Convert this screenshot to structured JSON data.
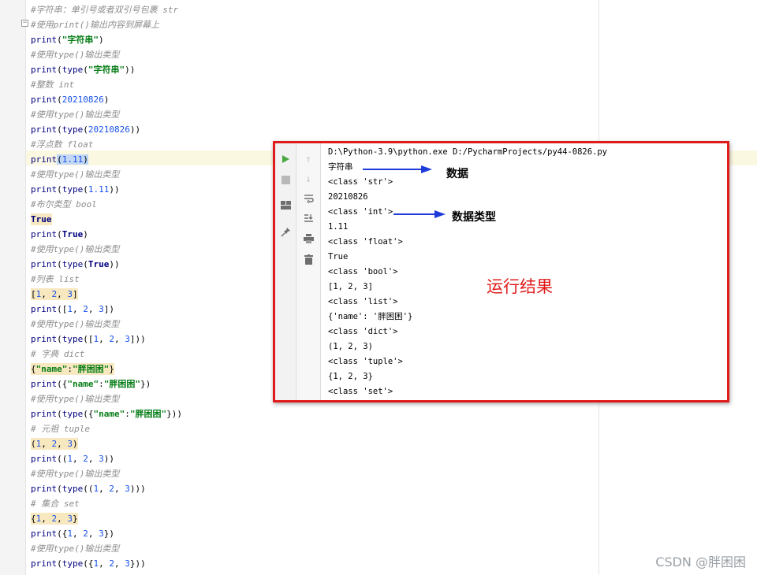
{
  "editor": {
    "lines": [
      {
        "kind": "comment",
        "text": "#字符串：单引号或者双引号包裹 str"
      },
      {
        "kind": "comment",
        "text": "#使用print()输出内容到屏幕上"
      },
      {
        "kind": "code",
        "parts": [
          {
            "c": "kw",
            "t": "print"
          },
          {
            "c": "",
            "t": "("
          },
          {
            "c": "str",
            "t": "\"字符串\""
          },
          {
            "c": "",
            "t": ")"
          }
        ]
      },
      {
        "kind": "comment",
        "text": "#使用type()输出类型"
      },
      {
        "kind": "code",
        "parts": [
          {
            "c": "kw",
            "t": "print"
          },
          {
            "c": "",
            "t": "("
          },
          {
            "c": "kw",
            "t": "type"
          },
          {
            "c": "",
            "t": "("
          },
          {
            "c": "str",
            "t": "\"字符串\""
          },
          {
            "c": "",
            "t": "))"
          }
        ]
      },
      {
        "kind": "comment",
        "text": "#整数 int"
      },
      {
        "kind": "code",
        "parts": [
          {
            "c": "kw",
            "t": "print"
          },
          {
            "c": "",
            "t": "("
          },
          {
            "c": "num",
            "t": "20210826"
          },
          {
            "c": "",
            "t": ")"
          }
        ]
      },
      {
        "kind": "comment",
        "text": "#使用type()输出类型"
      },
      {
        "kind": "code",
        "parts": [
          {
            "c": "kw",
            "t": "print"
          },
          {
            "c": "",
            "t": "("
          },
          {
            "c": "kw",
            "t": "type"
          },
          {
            "c": "",
            "t": "("
          },
          {
            "c": "num",
            "t": "20210826"
          },
          {
            "c": "",
            "t": "))"
          }
        ]
      },
      {
        "kind": "comment",
        "text": "#浮点数 float"
      },
      {
        "kind": "code",
        "parts": [
          {
            "c": "kw",
            "t": "print"
          },
          {
            "c": "brace-hl",
            "t": "("
          },
          {
            "c": "selnum",
            "t": "1.11"
          },
          {
            "c": "brace-hl",
            "t": ")"
          }
        ]
      },
      {
        "kind": "comment",
        "text": "#使用type()输出类型"
      },
      {
        "kind": "code",
        "parts": [
          {
            "c": "kw",
            "t": "print"
          },
          {
            "c": "",
            "t": "("
          },
          {
            "c": "kw",
            "t": "type"
          },
          {
            "c": "",
            "t": "("
          },
          {
            "c": "num",
            "t": "1.11"
          },
          {
            "c": "",
            "t": "))"
          }
        ]
      },
      {
        "kind": "comment",
        "text": "#布尔类型 bool"
      },
      {
        "kind": "code",
        "parts": [
          {
            "c": "kbold hl",
            "t": "True"
          }
        ]
      },
      {
        "kind": "code",
        "parts": [
          {
            "c": "kw",
            "t": "print"
          },
          {
            "c": "",
            "t": "("
          },
          {
            "c": "kbold",
            "t": "True"
          },
          {
            "c": "",
            "t": ")"
          }
        ]
      },
      {
        "kind": "comment",
        "text": "#使用type()输出类型"
      },
      {
        "kind": "code",
        "parts": [
          {
            "c": "kw",
            "t": "print"
          },
          {
            "c": "",
            "t": "("
          },
          {
            "c": "kw",
            "t": "type"
          },
          {
            "c": "",
            "t": "("
          },
          {
            "c": "kbold",
            "t": "True"
          },
          {
            "c": "",
            "t": "))"
          }
        ]
      },
      {
        "kind": "comment",
        "text": "#列表 list"
      },
      {
        "kind": "code",
        "parts": [
          {
            "c": "hl",
            "t": "["
          },
          {
            "c": "num hl",
            "t": "1"
          },
          {
            "c": "hl",
            "t": ", "
          },
          {
            "c": "num hl",
            "t": "2"
          },
          {
            "c": "hl",
            "t": ", "
          },
          {
            "c": "num hl",
            "t": "3"
          },
          {
            "c": "hl",
            "t": "]"
          }
        ]
      },
      {
        "kind": "code",
        "parts": [
          {
            "c": "kw",
            "t": "print"
          },
          {
            "c": "",
            "t": "(["
          },
          {
            "c": "num",
            "t": "1"
          },
          {
            "c": "",
            "t": ", "
          },
          {
            "c": "num",
            "t": "2"
          },
          {
            "c": "",
            "t": ", "
          },
          {
            "c": "num",
            "t": "3"
          },
          {
            "c": "",
            "t": "])"
          }
        ]
      },
      {
        "kind": "comment",
        "text": "#使用type()输出类型"
      },
      {
        "kind": "code",
        "parts": [
          {
            "c": "kw",
            "t": "print"
          },
          {
            "c": "",
            "t": "("
          },
          {
            "c": "kw",
            "t": "type"
          },
          {
            "c": "",
            "t": "(["
          },
          {
            "c": "num",
            "t": "1"
          },
          {
            "c": "",
            "t": ", "
          },
          {
            "c": "num",
            "t": "2"
          },
          {
            "c": "",
            "t": ", "
          },
          {
            "c": "num",
            "t": "3"
          },
          {
            "c": "",
            "t": "]))"
          }
        ]
      },
      {
        "kind": "comment",
        "text": "# 字典 dict"
      },
      {
        "kind": "code",
        "parts": [
          {
            "c": "hl",
            "t": "{"
          },
          {
            "c": "str hl",
            "t": "\"name\""
          },
          {
            "c": "hl",
            "t": ":"
          },
          {
            "c": "str hl",
            "t": "\"胖困困\""
          },
          {
            "c": "hl",
            "t": "}"
          }
        ]
      },
      {
        "kind": "code",
        "parts": [
          {
            "c": "kw",
            "t": "print"
          },
          {
            "c": "",
            "t": "({"
          },
          {
            "c": "str",
            "t": "\"name\""
          },
          {
            "c": "",
            "t": ":"
          },
          {
            "c": "str",
            "t": "\"胖困困\""
          },
          {
            "c": "",
            "t": "})"
          }
        ]
      },
      {
        "kind": "comment",
        "text": "#使用type()输出类型"
      },
      {
        "kind": "code",
        "parts": [
          {
            "c": "kw",
            "t": "print"
          },
          {
            "c": "",
            "t": "("
          },
          {
            "c": "kw",
            "t": "type"
          },
          {
            "c": "",
            "t": "({"
          },
          {
            "c": "str",
            "t": "\"name\""
          },
          {
            "c": "",
            "t": ":"
          },
          {
            "c": "str",
            "t": "\"胖困困\""
          },
          {
            "c": "",
            "t": "}))"
          }
        ]
      },
      {
        "kind": "comment",
        "text": "# 元祖 tuple"
      },
      {
        "kind": "code",
        "parts": [
          {
            "c": "hl",
            "t": "("
          },
          {
            "c": "num hl",
            "t": "1"
          },
          {
            "c": "hl",
            "t": ", "
          },
          {
            "c": "num hl",
            "t": "2"
          },
          {
            "c": "hl",
            "t": ", "
          },
          {
            "c": "num hl",
            "t": "3"
          },
          {
            "c": "hl",
            "t": ")"
          }
        ]
      },
      {
        "kind": "code",
        "parts": [
          {
            "c": "kw",
            "t": "print"
          },
          {
            "c": "",
            "t": "(("
          },
          {
            "c": "num",
            "t": "1"
          },
          {
            "c": "",
            "t": ", "
          },
          {
            "c": "num",
            "t": "2"
          },
          {
            "c": "",
            "t": ", "
          },
          {
            "c": "num",
            "t": "3"
          },
          {
            "c": "",
            "t": "))"
          }
        ]
      },
      {
        "kind": "comment",
        "text": "#使用type()输出类型"
      },
      {
        "kind": "code",
        "parts": [
          {
            "c": "kw",
            "t": "print"
          },
          {
            "c": "",
            "t": "("
          },
          {
            "c": "kw",
            "t": "type"
          },
          {
            "c": "",
            "t": "(("
          },
          {
            "c": "num",
            "t": "1"
          },
          {
            "c": "",
            "t": ", "
          },
          {
            "c": "num",
            "t": "2"
          },
          {
            "c": "",
            "t": ", "
          },
          {
            "c": "num",
            "t": "3"
          },
          {
            "c": "",
            "t": ")))"
          }
        ]
      },
      {
        "kind": "comment",
        "text": "# 集合 set"
      },
      {
        "kind": "code",
        "parts": [
          {
            "c": "hl",
            "t": "{"
          },
          {
            "c": "num hl",
            "t": "1"
          },
          {
            "c": "hl",
            "t": ", "
          },
          {
            "c": "num hl",
            "t": "2"
          },
          {
            "c": "hl",
            "t": ", "
          },
          {
            "c": "num hl",
            "t": "3"
          },
          {
            "c": "hl",
            "t": "}"
          }
        ]
      },
      {
        "kind": "code",
        "parts": [
          {
            "c": "kw",
            "t": "print"
          },
          {
            "c": "",
            "t": "({"
          },
          {
            "c": "num",
            "t": "1"
          },
          {
            "c": "",
            "t": ", "
          },
          {
            "c": "num",
            "t": "2"
          },
          {
            "c": "",
            "t": ", "
          },
          {
            "c": "num",
            "t": "3"
          },
          {
            "c": "",
            "t": "})"
          }
        ]
      },
      {
        "kind": "comment",
        "text": "#使用type()输出类型"
      },
      {
        "kind": "code",
        "parts": [
          {
            "c": "kw",
            "t": "print"
          },
          {
            "c": "",
            "t": "("
          },
          {
            "c": "kw",
            "t": "type"
          },
          {
            "c": "",
            "t": "({"
          },
          {
            "c": "num",
            "t": "1"
          },
          {
            "c": "",
            "t": ", "
          },
          {
            "c": "num",
            "t": "2"
          },
          {
            "c": "",
            "t": ", "
          },
          {
            "c": "num",
            "t": "3"
          },
          {
            "c": "",
            "t": "}))"
          }
        ]
      }
    ]
  },
  "run_panel": {
    "command": "D:\\Python-3.9\\python.exe D:/PycharmProjects/py44-0826.py",
    "output": [
      "字符串",
      "<class 'str'>",
      "20210826",
      "<class 'int'>",
      "1.11",
      "<class 'float'>",
      "True",
      "<class 'bool'>",
      "[1, 2, 3]",
      "<class 'list'>",
      "{'name': '胖困困'}",
      "<class 'dict'>",
      "(1, 2, 3)",
      "<class 'tuple'>",
      "{1, 2, 3}",
      "<class 'set'>"
    ],
    "annotation_data": "数据",
    "annotation_type": "数据类型",
    "result_label": "运行结果",
    "toolbar_icons": [
      "run-icon",
      "stop-icon",
      "layout-icon",
      "pin-icon",
      "up-arrow-icon",
      "down-arrow-icon",
      "soft-wrap-icon",
      "scroll-to-end-icon",
      "print-icon",
      "trash-icon"
    ]
  },
  "watermark": "CSDN @胖困困",
  "colors": {
    "highlight_box": "#e01b1b",
    "arrow": "#1f3cdb",
    "run_green": "#49a844"
  }
}
